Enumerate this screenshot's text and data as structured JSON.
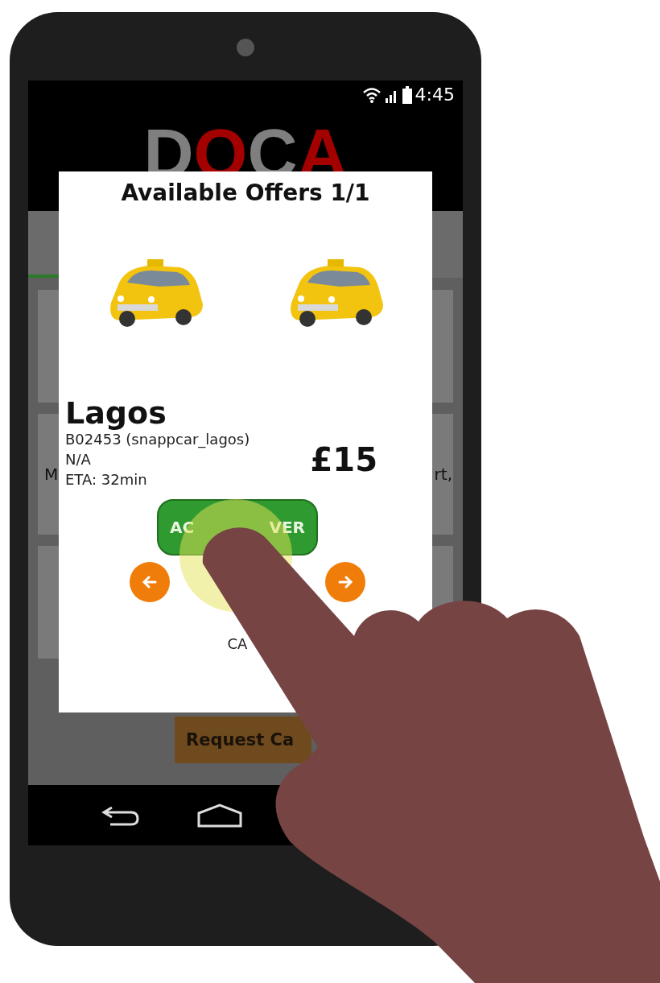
{
  "status_bar": {
    "time": "4:45"
  },
  "app_header": {
    "logo": [
      {
        "text": "D",
        "color": "#7f7f7f"
      },
      {
        "text": "O",
        "color": "#a30000"
      },
      {
        "text": "C",
        "color": "#7f7f7f"
      },
      {
        "text": "A",
        "color": "#a30000"
      }
    ]
  },
  "background_card": {
    "left_text": "M",
    "right_text": "rt,"
  },
  "request_button": {
    "label": "Request Ca"
  },
  "dialog": {
    "title": "Available Offers 1/1",
    "city": "Lagos",
    "details": [
      "B02453 (snappcar_lagos)",
      "N/A",
      "ETA: 32min"
    ],
    "price": "£15",
    "accept_button": {
      "label_start": "AC",
      "label_end": "VER"
    },
    "cancel": "CA"
  }
}
